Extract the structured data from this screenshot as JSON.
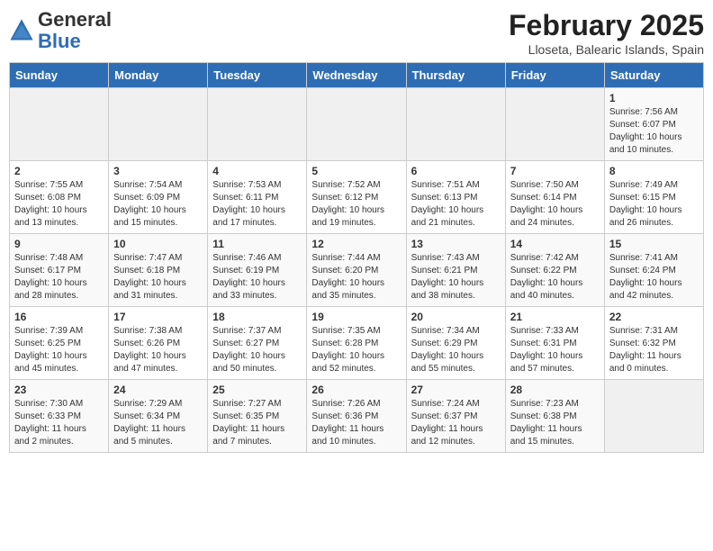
{
  "header": {
    "logo_general": "General",
    "logo_blue": "Blue",
    "month_title": "February 2025",
    "subtitle": "Lloseta, Balearic Islands, Spain"
  },
  "days_of_week": [
    "Sunday",
    "Monday",
    "Tuesday",
    "Wednesday",
    "Thursday",
    "Friday",
    "Saturday"
  ],
  "weeks": [
    [
      {
        "num": "",
        "detail": ""
      },
      {
        "num": "",
        "detail": ""
      },
      {
        "num": "",
        "detail": ""
      },
      {
        "num": "",
        "detail": ""
      },
      {
        "num": "",
        "detail": ""
      },
      {
        "num": "",
        "detail": ""
      },
      {
        "num": "1",
        "detail": "Sunrise: 7:56 AM\nSunset: 6:07 PM\nDaylight: 10 hours\nand 10 minutes."
      }
    ],
    [
      {
        "num": "2",
        "detail": "Sunrise: 7:55 AM\nSunset: 6:08 PM\nDaylight: 10 hours\nand 13 minutes."
      },
      {
        "num": "3",
        "detail": "Sunrise: 7:54 AM\nSunset: 6:09 PM\nDaylight: 10 hours\nand 15 minutes."
      },
      {
        "num": "4",
        "detail": "Sunrise: 7:53 AM\nSunset: 6:11 PM\nDaylight: 10 hours\nand 17 minutes."
      },
      {
        "num": "5",
        "detail": "Sunrise: 7:52 AM\nSunset: 6:12 PM\nDaylight: 10 hours\nand 19 minutes."
      },
      {
        "num": "6",
        "detail": "Sunrise: 7:51 AM\nSunset: 6:13 PM\nDaylight: 10 hours\nand 21 minutes."
      },
      {
        "num": "7",
        "detail": "Sunrise: 7:50 AM\nSunset: 6:14 PM\nDaylight: 10 hours\nand 24 minutes."
      },
      {
        "num": "8",
        "detail": "Sunrise: 7:49 AM\nSunset: 6:15 PM\nDaylight: 10 hours\nand 26 minutes."
      }
    ],
    [
      {
        "num": "9",
        "detail": "Sunrise: 7:48 AM\nSunset: 6:17 PM\nDaylight: 10 hours\nand 28 minutes."
      },
      {
        "num": "10",
        "detail": "Sunrise: 7:47 AM\nSunset: 6:18 PM\nDaylight: 10 hours\nand 31 minutes."
      },
      {
        "num": "11",
        "detail": "Sunrise: 7:46 AM\nSunset: 6:19 PM\nDaylight: 10 hours\nand 33 minutes."
      },
      {
        "num": "12",
        "detail": "Sunrise: 7:44 AM\nSunset: 6:20 PM\nDaylight: 10 hours\nand 35 minutes."
      },
      {
        "num": "13",
        "detail": "Sunrise: 7:43 AM\nSunset: 6:21 PM\nDaylight: 10 hours\nand 38 minutes."
      },
      {
        "num": "14",
        "detail": "Sunrise: 7:42 AM\nSunset: 6:22 PM\nDaylight: 10 hours\nand 40 minutes."
      },
      {
        "num": "15",
        "detail": "Sunrise: 7:41 AM\nSunset: 6:24 PM\nDaylight: 10 hours\nand 42 minutes."
      }
    ],
    [
      {
        "num": "16",
        "detail": "Sunrise: 7:39 AM\nSunset: 6:25 PM\nDaylight: 10 hours\nand 45 minutes."
      },
      {
        "num": "17",
        "detail": "Sunrise: 7:38 AM\nSunset: 6:26 PM\nDaylight: 10 hours\nand 47 minutes."
      },
      {
        "num": "18",
        "detail": "Sunrise: 7:37 AM\nSunset: 6:27 PM\nDaylight: 10 hours\nand 50 minutes."
      },
      {
        "num": "19",
        "detail": "Sunrise: 7:35 AM\nSunset: 6:28 PM\nDaylight: 10 hours\nand 52 minutes."
      },
      {
        "num": "20",
        "detail": "Sunrise: 7:34 AM\nSunset: 6:29 PM\nDaylight: 10 hours\nand 55 minutes."
      },
      {
        "num": "21",
        "detail": "Sunrise: 7:33 AM\nSunset: 6:31 PM\nDaylight: 10 hours\nand 57 minutes."
      },
      {
        "num": "22",
        "detail": "Sunrise: 7:31 AM\nSunset: 6:32 PM\nDaylight: 11 hours\nand 0 minutes."
      }
    ],
    [
      {
        "num": "23",
        "detail": "Sunrise: 7:30 AM\nSunset: 6:33 PM\nDaylight: 11 hours\nand 2 minutes."
      },
      {
        "num": "24",
        "detail": "Sunrise: 7:29 AM\nSunset: 6:34 PM\nDaylight: 11 hours\nand 5 minutes."
      },
      {
        "num": "25",
        "detail": "Sunrise: 7:27 AM\nSunset: 6:35 PM\nDaylight: 11 hours\nand 7 minutes."
      },
      {
        "num": "26",
        "detail": "Sunrise: 7:26 AM\nSunset: 6:36 PM\nDaylight: 11 hours\nand 10 minutes."
      },
      {
        "num": "27",
        "detail": "Sunrise: 7:24 AM\nSunset: 6:37 PM\nDaylight: 11 hours\nand 12 minutes."
      },
      {
        "num": "28",
        "detail": "Sunrise: 7:23 AM\nSunset: 6:38 PM\nDaylight: 11 hours\nand 15 minutes."
      },
      {
        "num": "",
        "detail": ""
      }
    ]
  ]
}
